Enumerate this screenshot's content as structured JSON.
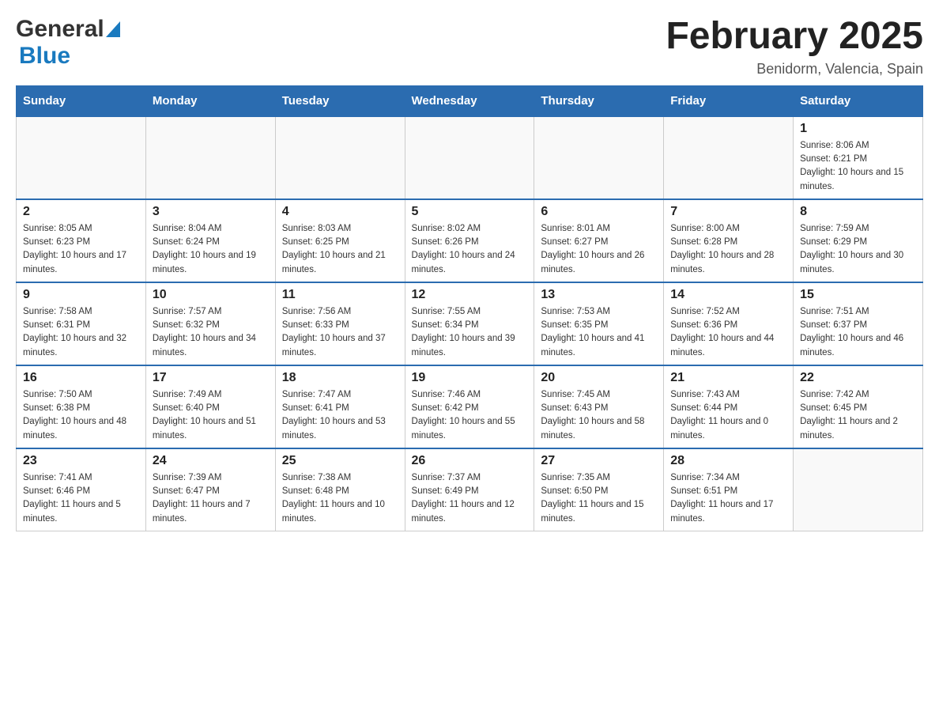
{
  "header": {
    "logo_general": "General",
    "logo_blue": "Blue",
    "month_title": "February 2025",
    "location": "Benidorm, Valencia, Spain"
  },
  "weekdays": [
    "Sunday",
    "Monday",
    "Tuesday",
    "Wednesday",
    "Thursday",
    "Friday",
    "Saturday"
  ],
  "weeks": [
    [
      {
        "day": "",
        "info": ""
      },
      {
        "day": "",
        "info": ""
      },
      {
        "day": "",
        "info": ""
      },
      {
        "day": "",
        "info": ""
      },
      {
        "day": "",
        "info": ""
      },
      {
        "day": "",
        "info": ""
      },
      {
        "day": "1",
        "info": "Sunrise: 8:06 AM\nSunset: 6:21 PM\nDaylight: 10 hours and 15 minutes."
      }
    ],
    [
      {
        "day": "2",
        "info": "Sunrise: 8:05 AM\nSunset: 6:23 PM\nDaylight: 10 hours and 17 minutes."
      },
      {
        "day": "3",
        "info": "Sunrise: 8:04 AM\nSunset: 6:24 PM\nDaylight: 10 hours and 19 minutes."
      },
      {
        "day": "4",
        "info": "Sunrise: 8:03 AM\nSunset: 6:25 PM\nDaylight: 10 hours and 21 minutes."
      },
      {
        "day": "5",
        "info": "Sunrise: 8:02 AM\nSunset: 6:26 PM\nDaylight: 10 hours and 24 minutes."
      },
      {
        "day": "6",
        "info": "Sunrise: 8:01 AM\nSunset: 6:27 PM\nDaylight: 10 hours and 26 minutes."
      },
      {
        "day": "7",
        "info": "Sunrise: 8:00 AM\nSunset: 6:28 PM\nDaylight: 10 hours and 28 minutes."
      },
      {
        "day": "8",
        "info": "Sunrise: 7:59 AM\nSunset: 6:29 PM\nDaylight: 10 hours and 30 minutes."
      }
    ],
    [
      {
        "day": "9",
        "info": "Sunrise: 7:58 AM\nSunset: 6:31 PM\nDaylight: 10 hours and 32 minutes."
      },
      {
        "day": "10",
        "info": "Sunrise: 7:57 AM\nSunset: 6:32 PM\nDaylight: 10 hours and 34 minutes."
      },
      {
        "day": "11",
        "info": "Sunrise: 7:56 AM\nSunset: 6:33 PM\nDaylight: 10 hours and 37 minutes."
      },
      {
        "day": "12",
        "info": "Sunrise: 7:55 AM\nSunset: 6:34 PM\nDaylight: 10 hours and 39 minutes."
      },
      {
        "day": "13",
        "info": "Sunrise: 7:53 AM\nSunset: 6:35 PM\nDaylight: 10 hours and 41 minutes."
      },
      {
        "day": "14",
        "info": "Sunrise: 7:52 AM\nSunset: 6:36 PM\nDaylight: 10 hours and 44 minutes."
      },
      {
        "day": "15",
        "info": "Sunrise: 7:51 AM\nSunset: 6:37 PM\nDaylight: 10 hours and 46 minutes."
      }
    ],
    [
      {
        "day": "16",
        "info": "Sunrise: 7:50 AM\nSunset: 6:38 PM\nDaylight: 10 hours and 48 minutes."
      },
      {
        "day": "17",
        "info": "Sunrise: 7:49 AM\nSunset: 6:40 PM\nDaylight: 10 hours and 51 minutes."
      },
      {
        "day": "18",
        "info": "Sunrise: 7:47 AM\nSunset: 6:41 PM\nDaylight: 10 hours and 53 minutes."
      },
      {
        "day": "19",
        "info": "Sunrise: 7:46 AM\nSunset: 6:42 PM\nDaylight: 10 hours and 55 minutes."
      },
      {
        "day": "20",
        "info": "Sunrise: 7:45 AM\nSunset: 6:43 PM\nDaylight: 10 hours and 58 minutes."
      },
      {
        "day": "21",
        "info": "Sunrise: 7:43 AM\nSunset: 6:44 PM\nDaylight: 11 hours and 0 minutes."
      },
      {
        "day": "22",
        "info": "Sunrise: 7:42 AM\nSunset: 6:45 PM\nDaylight: 11 hours and 2 minutes."
      }
    ],
    [
      {
        "day": "23",
        "info": "Sunrise: 7:41 AM\nSunset: 6:46 PM\nDaylight: 11 hours and 5 minutes."
      },
      {
        "day": "24",
        "info": "Sunrise: 7:39 AM\nSunset: 6:47 PM\nDaylight: 11 hours and 7 minutes."
      },
      {
        "day": "25",
        "info": "Sunrise: 7:38 AM\nSunset: 6:48 PM\nDaylight: 11 hours and 10 minutes."
      },
      {
        "day": "26",
        "info": "Sunrise: 7:37 AM\nSunset: 6:49 PM\nDaylight: 11 hours and 12 minutes."
      },
      {
        "day": "27",
        "info": "Sunrise: 7:35 AM\nSunset: 6:50 PM\nDaylight: 11 hours and 15 minutes."
      },
      {
        "day": "28",
        "info": "Sunrise: 7:34 AM\nSunset: 6:51 PM\nDaylight: 11 hours and 17 minutes."
      },
      {
        "day": "",
        "info": ""
      }
    ]
  ]
}
